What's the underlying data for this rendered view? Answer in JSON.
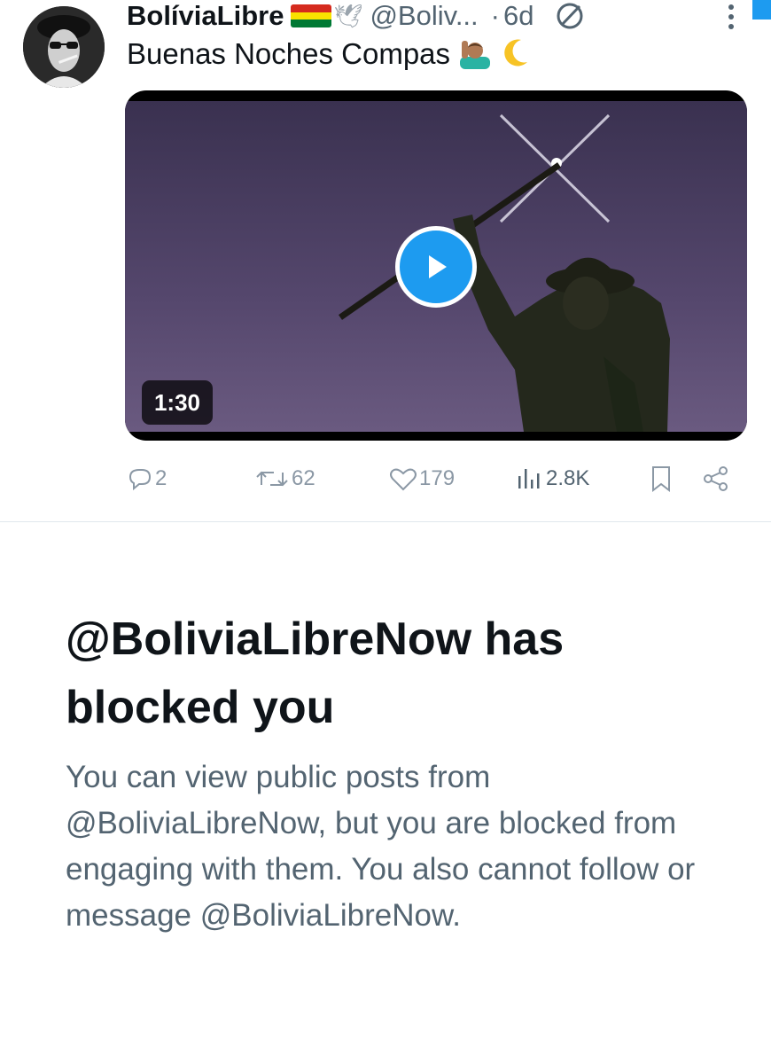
{
  "post": {
    "author_name": "BolíviaLibre",
    "handle": "@Boliv...",
    "separator": "·",
    "time": "6d",
    "text": "Buenas Noches Compas",
    "media": {
      "duration": "1:30"
    },
    "stats": {
      "replies": "2",
      "reposts": "62",
      "likes": "179",
      "views": "2.8K"
    },
    "icons": [
      "reply-icon",
      "repost-icon",
      "like-icon",
      "views-icon",
      "bookmark-icon",
      "share-icon",
      "play-icon",
      "more-icon",
      "not-interested-icon"
    ]
  },
  "block_notice": {
    "title": "@BoliviaLibreNow has blocked you",
    "description": "You can view public posts from @BoliviaLibreNow, but you are blocked from engaging with them. You also cannot follow or message @BoliviaLibreNow."
  },
  "colors": {
    "accent": "#1d9bf0",
    "text_primary": "#0f1419",
    "text_secondary": "#536471",
    "icon_gray": "#8b98a5"
  }
}
